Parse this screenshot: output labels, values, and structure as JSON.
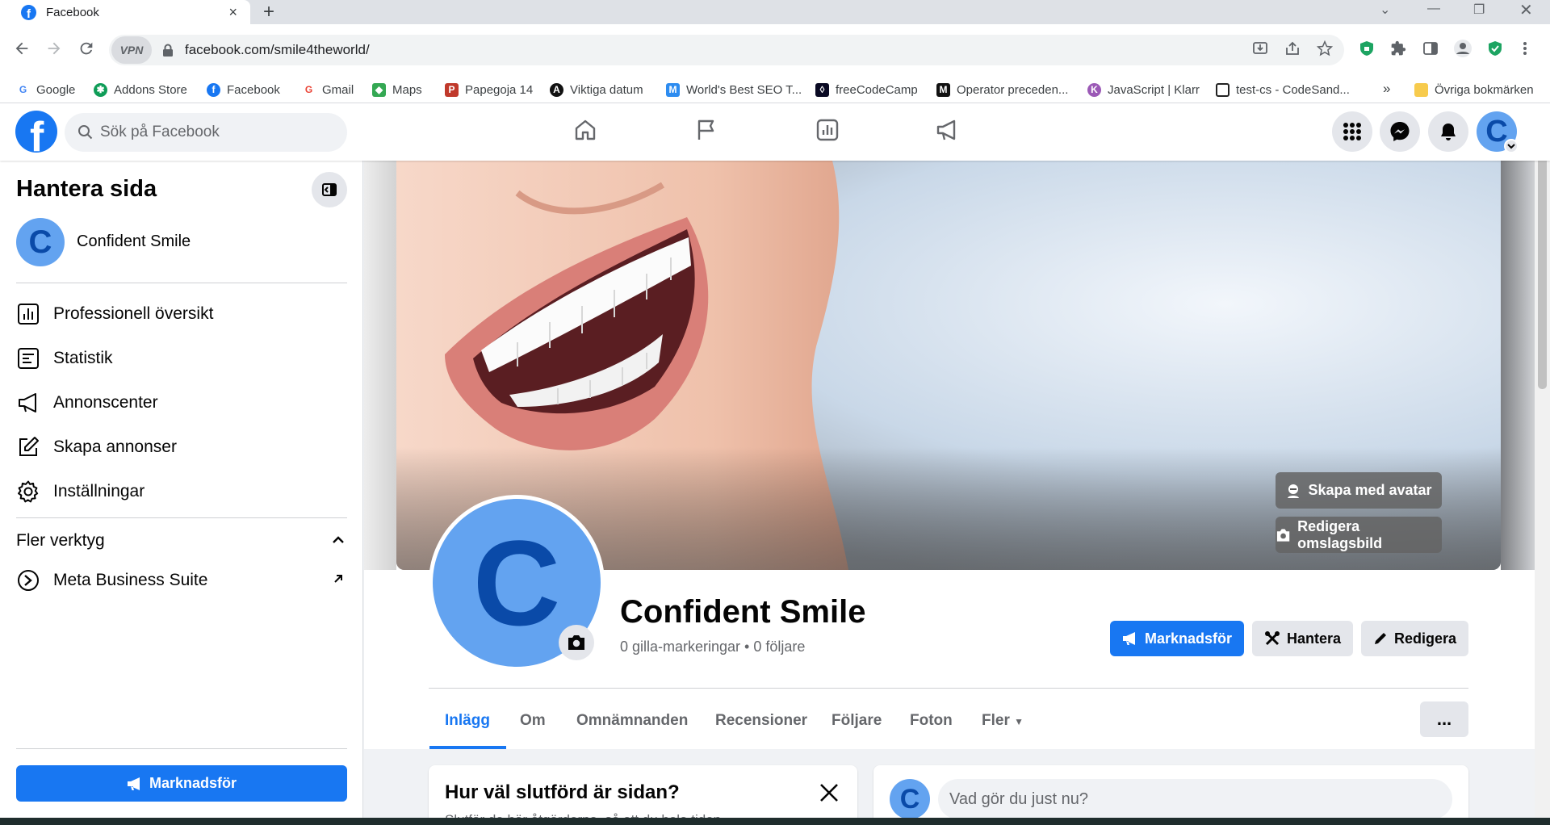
{
  "browser": {
    "tab_title": "Facebook",
    "tab_close": "×",
    "new_tab": "+",
    "vpn_label": "VPN",
    "url": "facebook.com/smile4theworld/",
    "bookmarks": [
      {
        "label": "Google",
        "icon": "google-icon",
        "color": "#4285f4"
      },
      {
        "label": "Addons Store",
        "icon": "addons-icon",
        "color": "#0f9d58"
      },
      {
        "label": "Facebook",
        "icon": "facebook-icon",
        "color": "#1877f2"
      },
      {
        "label": "Gmail",
        "icon": "google-icon",
        "color": "#ea4335"
      },
      {
        "label": "Maps",
        "icon": "maps-icon",
        "color": "#34a853"
      },
      {
        "label": "Papegoja 14",
        "icon": "papegoja-icon",
        "color": "#c0392b"
      },
      {
        "label": "Viktiga datum",
        "icon": "viktiga-icon",
        "color": "#111111"
      },
      {
        "label": "World's Best SEO T...",
        "icon": "seo-icon",
        "color": "#2d8cf0"
      },
      {
        "label": "freeCodeCamp",
        "icon": "freecodecamp-icon",
        "color": "#0a0a23"
      },
      {
        "label": "Operator preceden...",
        "icon": "mdn-icon",
        "color": "#111111"
      },
      {
        "label": "JavaScript | Klarr",
        "icon": "klarr-icon",
        "color": "#9b59b6"
      },
      {
        "label": "test-cs - CodeSand...",
        "icon": "codesandbox-icon",
        "color": "#ffffff"
      }
    ],
    "bookmarks_more": "»",
    "other_bookmarks": "Övriga bokmärken"
  },
  "fb_header": {
    "logo_letter": "f",
    "search_placeholder": "Sök på Facebook",
    "avatar_letter": "C"
  },
  "sidebar": {
    "title": "Hantera sida",
    "page_letter": "C",
    "page_name": "Confident Smile",
    "items": [
      {
        "label": "Professionell översikt",
        "icon": "dashboard-icon"
      },
      {
        "label": "Statistik",
        "icon": "statistics-icon"
      },
      {
        "label": "Annonscenter",
        "icon": "megaphone-icon"
      },
      {
        "label": "Skapa annonser",
        "icon": "edit-icon"
      },
      {
        "label": "Inställningar",
        "icon": "gear-icon"
      }
    ],
    "more_tools": "Fler verktyg",
    "meta_business": "Meta Business Suite",
    "promote": "Marknadsför"
  },
  "profile": {
    "letter": "C",
    "name": "Confident Smile",
    "stats": "0 gilla-markeringar • 0 följare",
    "avatar_button": "Skapa med avatar",
    "edit_cover_button": "Redigera omslagsbild",
    "actions": {
      "promote": "Marknadsför",
      "manage": "Hantera",
      "edit": "Redigera"
    },
    "tabs": [
      "Inlägg",
      "Om",
      "Omnämnanden",
      "Recensioner",
      "Följare",
      "Foton",
      "Fler"
    ],
    "active_tab": "Inlägg",
    "more_dots": "..."
  },
  "cards": {
    "completion_title": "Hur väl slutförd är sidan?",
    "completion_sub": "Slutför de här åtgärderna, så att du hela tiden",
    "composer_letter": "C",
    "composer_placeholder": "Vad gör du just nu?"
  },
  "colors": {
    "facebook_blue": "#1877f2",
    "avatar_fill": "#63a3f0",
    "avatar_letter": "#0a4aa8"
  }
}
